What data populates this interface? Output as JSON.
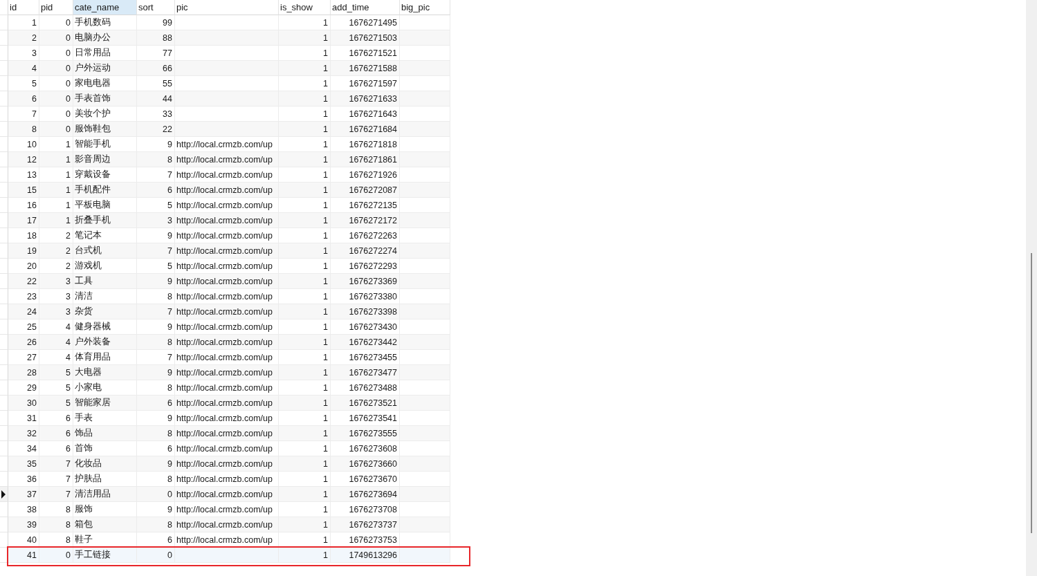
{
  "table": {
    "columns": [
      {
        "label": "id",
        "kind": "number",
        "selected": false
      },
      {
        "label": "pid",
        "kind": "number",
        "selected": false
      },
      {
        "label": "cate_name",
        "kind": "text",
        "selected": true
      },
      {
        "label": "sort",
        "kind": "number",
        "selected": false
      },
      {
        "label": "pic",
        "kind": "text",
        "selected": false
      },
      {
        "label": "is_show",
        "kind": "number",
        "selected": false
      },
      {
        "label": "add_time",
        "kind": "number",
        "selected": false
      },
      {
        "label": "big_pic",
        "kind": "text",
        "selected": false
      }
    ],
    "rows": [
      {
        "id": "1",
        "pid": "0",
        "cate_name": "手机数码",
        "sort": "99",
        "is_show": "1",
        "add_time": "1676271495",
        "current": false,
        "highlighted": false
      },
      {
        "id": "2",
        "pid": "0",
        "cate_name": "电脑办公",
        "sort": "88",
        "is_show": "1",
        "add_time": "1676271503",
        "current": false,
        "highlighted": false
      },
      {
        "id": "3",
        "pid": "0",
        "cate_name": "日常用品",
        "sort": "77",
        "is_show": "1",
        "add_time": "1676271521",
        "current": false,
        "highlighted": false
      },
      {
        "id": "4",
        "pid": "0",
        "cate_name": "户外运动",
        "sort": "66",
        "is_show": "1",
        "add_time": "1676271588",
        "current": false,
        "highlighted": false
      },
      {
        "id": "5",
        "pid": "0",
        "cate_name": "家电电器",
        "sort": "55",
        "is_show": "1",
        "add_time": "1676271597",
        "current": false,
        "highlighted": false
      },
      {
        "id": "6",
        "pid": "0",
        "cate_name": "手表首饰",
        "sort": "44",
        "is_show": "1",
        "add_time": "1676271633",
        "current": false,
        "highlighted": false
      },
      {
        "id": "7",
        "pid": "0",
        "cate_name": "美妆个护",
        "sort": "33",
        "is_show": "1",
        "add_time": "1676271643",
        "current": false,
        "highlighted": false
      },
      {
        "id": "8",
        "pid": "0",
        "cate_name": "服饰鞋包",
        "sort": "22",
        "is_show": "1",
        "add_time": "1676271684",
        "current": false,
        "highlighted": false
      },
      {
        "id": "10",
        "pid": "1",
        "cate_name": "智能手机",
        "sort": "9",
        "pic": "http://local.crmzb.com/up",
        "is_show": "1",
        "add_time": "1676271818",
        "current": false,
        "highlighted": false
      },
      {
        "id": "12",
        "pid": "1",
        "cate_name": "影音周边",
        "sort": "8",
        "pic": "http://local.crmzb.com/up",
        "is_show": "1",
        "add_time": "1676271861",
        "current": false,
        "highlighted": false
      },
      {
        "id": "13",
        "pid": "1",
        "cate_name": "穿戴设备",
        "sort": "7",
        "pic": "http://local.crmzb.com/up",
        "is_show": "1",
        "add_time": "1676271926",
        "current": false,
        "highlighted": false
      },
      {
        "id": "15",
        "pid": "1",
        "cate_name": "手机配件",
        "sort": "6",
        "pic": "http://local.crmzb.com/up",
        "is_show": "1",
        "add_time": "1676272087",
        "current": false,
        "highlighted": false
      },
      {
        "id": "16",
        "pid": "1",
        "cate_name": "平板电脑",
        "sort": "5",
        "pic": "http://local.crmzb.com/up",
        "is_show": "1",
        "add_time": "1676272135",
        "current": false,
        "highlighted": false
      },
      {
        "id": "17",
        "pid": "1",
        "cate_name": "折叠手机",
        "sort": "3",
        "pic": "http://local.crmzb.com/up",
        "is_show": "1",
        "add_time": "1676272172",
        "current": false,
        "highlighted": false
      },
      {
        "id": "18",
        "pid": "2",
        "cate_name": "笔记本",
        "sort": "9",
        "pic": "http://local.crmzb.com/up",
        "is_show": "1",
        "add_time": "1676272263",
        "current": false,
        "highlighted": false
      },
      {
        "id": "19",
        "pid": "2",
        "cate_name": "台式机",
        "sort": "7",
        "pic": "http://local.crmzb.com/up",
        "is_show": "1",
        "add_time": "1676272274",
        "current": false,
        "highlighted": false
      },
      {
        "id": "20",
        "pid": "2",
        "cate_name": "游戏机",
        "sort": "5",
        "pic": "http://local.crmzb.com/up",
        "is_show": "1",
        "add_time": "1676272293",
        "current": false,
        "highlighted": false
      },
      {
        "id": "22",
        "pid": "3",
        "cate_name": "工具",
        "sort": "9",
        "pic": "http://local.crmzb.com/up",
        "is_show": "1",
        "add_time": "1676273369",
        "current": false,
        "highlighted": false
      },
      {
        "id": "23",
        "pid": "3",
        "cate_name": "清洁",
        "sort": "8",
        "pic": "http://local.crmzb.com/up",
        "is_show": "1",
        "add_time": "1676273380",
        "current": false,
        "highlighted": false
      },
      {
        "id": "24",
        "pid": "3",
        "cate_name": "杂货",
        "sort": "7",
        "pic": "http://local.crmzb.com/up",
        "is_show": "1",
        "add_time": "1676273398",
        "current": false,
        "highlighted": false
      },
      {
        "id": "25",
        "pid": "4",
        "cate_name": "健身器械",
        "sort": "9",
        "pic": "http://local.crmzb.com/up",
        "is_show": "1",
        "add_time": "1676273430",
        "current": false,
        "highlighted": false
      },
      {
        "id": "26",
        "pid": "4",
        "cate_name": "户外装备",
        "sort": "8",
        "pic": "http://local.crmzb.com/up",
        "is_show": "1",
        "add_time": "1676273442",
        "current": false,
        "highlighted": false
      },
      {
        "id": "27",
        "pid": "4",
        "cate_name": "体育用品",
        "sort": "7",
        "pic": "http://local.crmzb.com/up",
        "is_show": "1",
        "add_time": "1676273455",
        "current": false,
        "highlighted": false
      },
      {
        "id": "28",
        "pid": "5",
        "cate_name": "大电器",
        "sort": "9",
        "pic": "http://local.crmzb.com/up",
        "is_show": "1",
        "add_time": "1676273477",
        "current": false,
        "highlighted": false
      },
      {
        "id": "29",
        "pid": "5",
        "cate_name": "小家电",
        "sort": "8",
        "pic": "http://local.crmzb.com/up",
        "is_show": "1",
        "add_time": "1676273488",
        "current": false,
        "highlighted": false
      },
      {
        "id": "30",
        "pid": "5",
        "cate_name": "智能家居",
        "sort": "6",
        "pic": "http://local.crmzb.com/up",
        "is_show": "1",
        "add_time": "1676273521",
        "current": false,
        "highlighted": false
      },
      {
        "id": "31",
        "pid": "6",
        "cate_name": "手表",
        "sort": "9",
        "pic": "http://local.crmzb.com/up",
        "is_show": "1",
        "add_time": "1676273541",
        "current": false,
        "highlighted": false
      },
      {
        "id": "32",
        "pid": "6",
        "cate_name": "饰品",
        "sort": "8",
        "pic": "http://local.crmzb.com/up",
        "is_show": "1",
        "add_time": "1676273555",
        "current": false,
        "highlighted": false
      },
      {
        "id": "34",
        "pid": "6",
        "cate_name": "首饰",
        "sort": "6",
        "pic": "http://local.crmzb.com/up",
        "is_show": "1",
        "add_time": "1676273608",
        "current": false,
        "highlighted": false
      },
      {
        "id": "35",
        "pid": "7",
        "cate_name": "化妆品",
        "sort": "9",
        "pic": "http://local.crmzb.com/up",
        "is_show": "1",
        "add_time": "1676273660",
        "current": false,
        "highlighted": false
      },
      {
        "id": "36",
        "pid": "7",
        "cate_name": "护肤品",
        "sort": "8",
        "pic": "http://local.crmzb.com/up",
        "is_show": "1",
        "add_time": "1676273670",
        "current": false,
        "highlighted": false
      },
      {
        "id": "37",
        "pid": "7",
        "cate_name": "清洁用品",
        "sort": "0",
        "pic": "http://local.crmzb.com/up",
        "is_show": "1",
        "add_time": "1676273694",
        "current": true,
        "highlighted": false
      },
      {
        "id": "38",
        "pid": "8",
        "cate_name": "服饰",
        "sort": "9",
        "pic": "http://local.crmzb.com/up",
        "is_show": "1",
        "add_time": "1676273708",
        "current": false,
        "highlighted": false
      },
      {
        "id": "39",
        "pid": "8",
        "cate_name": "箱包",
        "sort": "8",
        "pic": "http://local.crmzb.com/up",
        "is_show": "1",
        "add_time": "1676273737",
        "current": false,
        "highlighted": false
      },
      {
        "id": "40",
        "pid": "8",
        "cate_name": "鞋子",
        "sort": "6",
        "pic": "http://local.crmzb.com/up",
        "is_show": "1",
        "add_time": "1676273753",
        "current": false,
        "highlighted": false
      },
      {
        "id": "41",
        "pid": "0",
        "cate_name": "手工链接",
        "sort": "0",
        "is_show": "1",
        "add_time": "1749613296",
        "current": false,
        "highlighted": true
      }
    ]
  }
}
